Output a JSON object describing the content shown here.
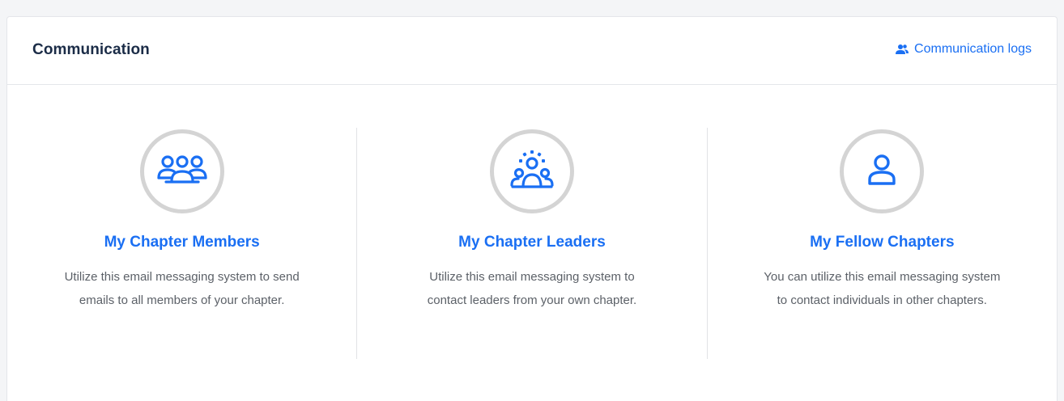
{
  "card": {
    "title": "Communication",
    "logs_link": {
      "label": "Communication logs",
      "icon": "users-icon"
    }
  },
  "options": [
    {
      "icon": "group-icon",
      "title": "My Chapter Members",
      "description": "Utilize this email messaging system to send emails to all members of your chapter."
    },
    {
      "icon": "leader-icon",
      "title": "My Chapter Leaders",
      "description": "Utilize this email messaging system to contact leaders from your own chapter."
    },
    {
      "icon": "person-icon",
      "title": "My Fellow Chapters",
      "description": "You can utilize this email messaging system to contact individuals in other chapters."
    }
  ],
  "colors": {
    "accent": "#1a6ff3",
    "title": "#1b2c47",
    "text": "#5c6168",
    "ring": "#d4d4d4"
  }
}
